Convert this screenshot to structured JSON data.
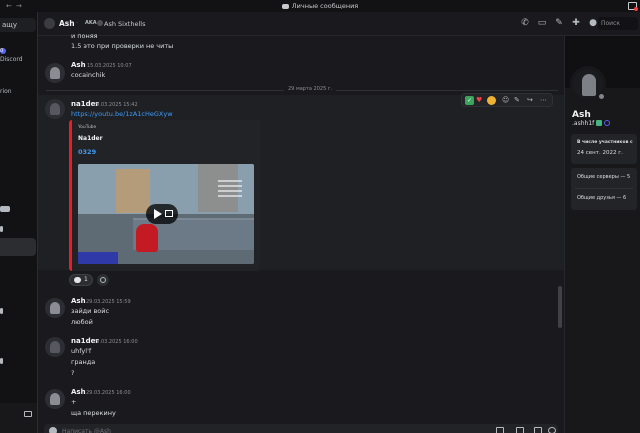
{
  "titlebar": {
    "title": "Личные сообщения",
    "back": "←",
    "forward": "→"
  },
  "sidebar": {
    "search_label": "ащу",
    "items": [
      {
        "text": "0",
        "kind": "badge"
      },
      {
        "text": "Discord",
        "kind": "text"
      },
      {
        "text": "rion",
        "kind": "text"
      }
    ]
  },
  "header": {
    "name": "Ash",
    "aka_label": "AKA",
    "aka_name": "Ash Sixthells",
    "search_placeholder": "Поиск"
  },
  "messages": {
    "top_line1": "и поняя",
    "top_line2": "1.5 это при проверки не читы",
    "m1": {
      "author": "Ash",
      "time": "15.03.2025 10:07",
      "text": "cocainchik"
    },
    "date_divider": "29 марта 2025 г.",
    "m2": {
      "author": "na1der",
      "time": "29.03.2025 15:42",
      "link": "https://youtu.be/1zA1cHeGXyw",
      "embed": {
        "provider": "YouTube",
        "author": "Na1der",
        "title": "0329"
      },
      "reaction_count": "1"
    },
    "m3": {
      "author": "Ash",
      "time": "29.03.2025 15:59",
      "line1": "зайди войс",
      "line2": "любой"
    },
    "m4": {
      "author": "na1der",
      "time": "29.03.2025 16:00",
      "line1": "uhfyl'f",
      "line2": "гранда",
      "line3": "?"
    },
    "m5": {
      "author": "Ash",
      "time": "29.03.2025 16:00",
      "line1": "+",
      "line2": "ща перекину"
    }
  },
  "composer": {
    "placeholder": "Написать @Ash"
  },
  "profile": {
    "name": "Ash",
    "username": ".ashh1f",
    "member_since_label": "В числе участников с",
    "member_since": "24 сент. 2022 г.",
    "mutual_servers": "Общие серверы — 5",
    "mutual_friends": "Общие друзья — 6"
  }
}
